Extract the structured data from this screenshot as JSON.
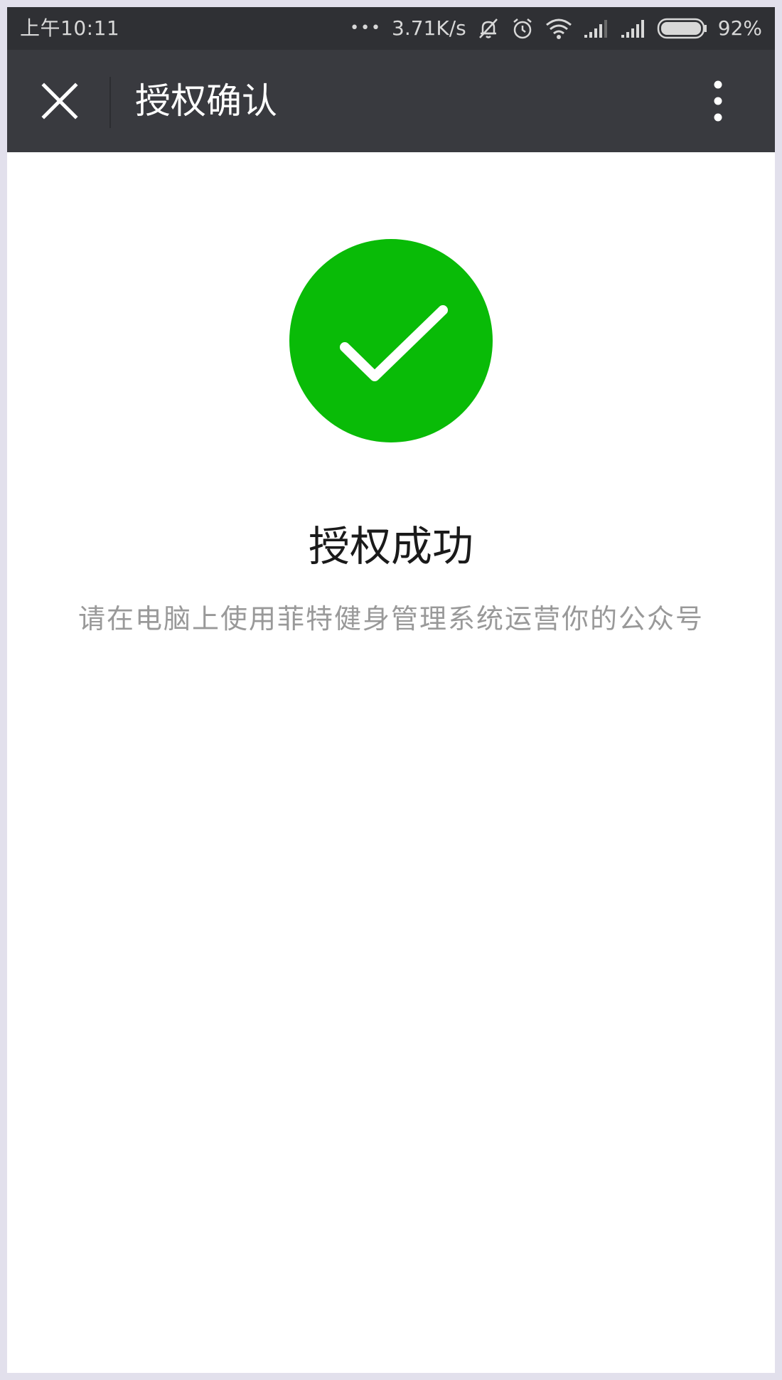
{
  "status_bar": {
    "time": "上午10:11",
    "dots": "•••",
    "net_speed": "3.71K/s",
    "battery_percent": "92%",
    "battery_level": 0.92,
    "icons": [
      "mute-bell-icon",
      "alarm-icon",
      "wifi-icon",
      "signal-1-icon",
      "signal-2-icon",
      "battery-icon"
    ]
  },
  "nav": {
    "title": "授权确认",
    "close_icon": "close-icon",
    "more_icon": "more-vertical-icon"
  },
  "content": {
    "icon": "success-check-icon",
    "title": "授权成功",
    "description": "请在电脑上使用菲特健身管理系统运营你的公众号"
  },
  "colors": {
    "status_bar_bg": "#2f3034",
    "nav_bar_bg": "#393a3f",
    "success_green": "#09bb07",
    "description_gray": "#999999"
  }
}
